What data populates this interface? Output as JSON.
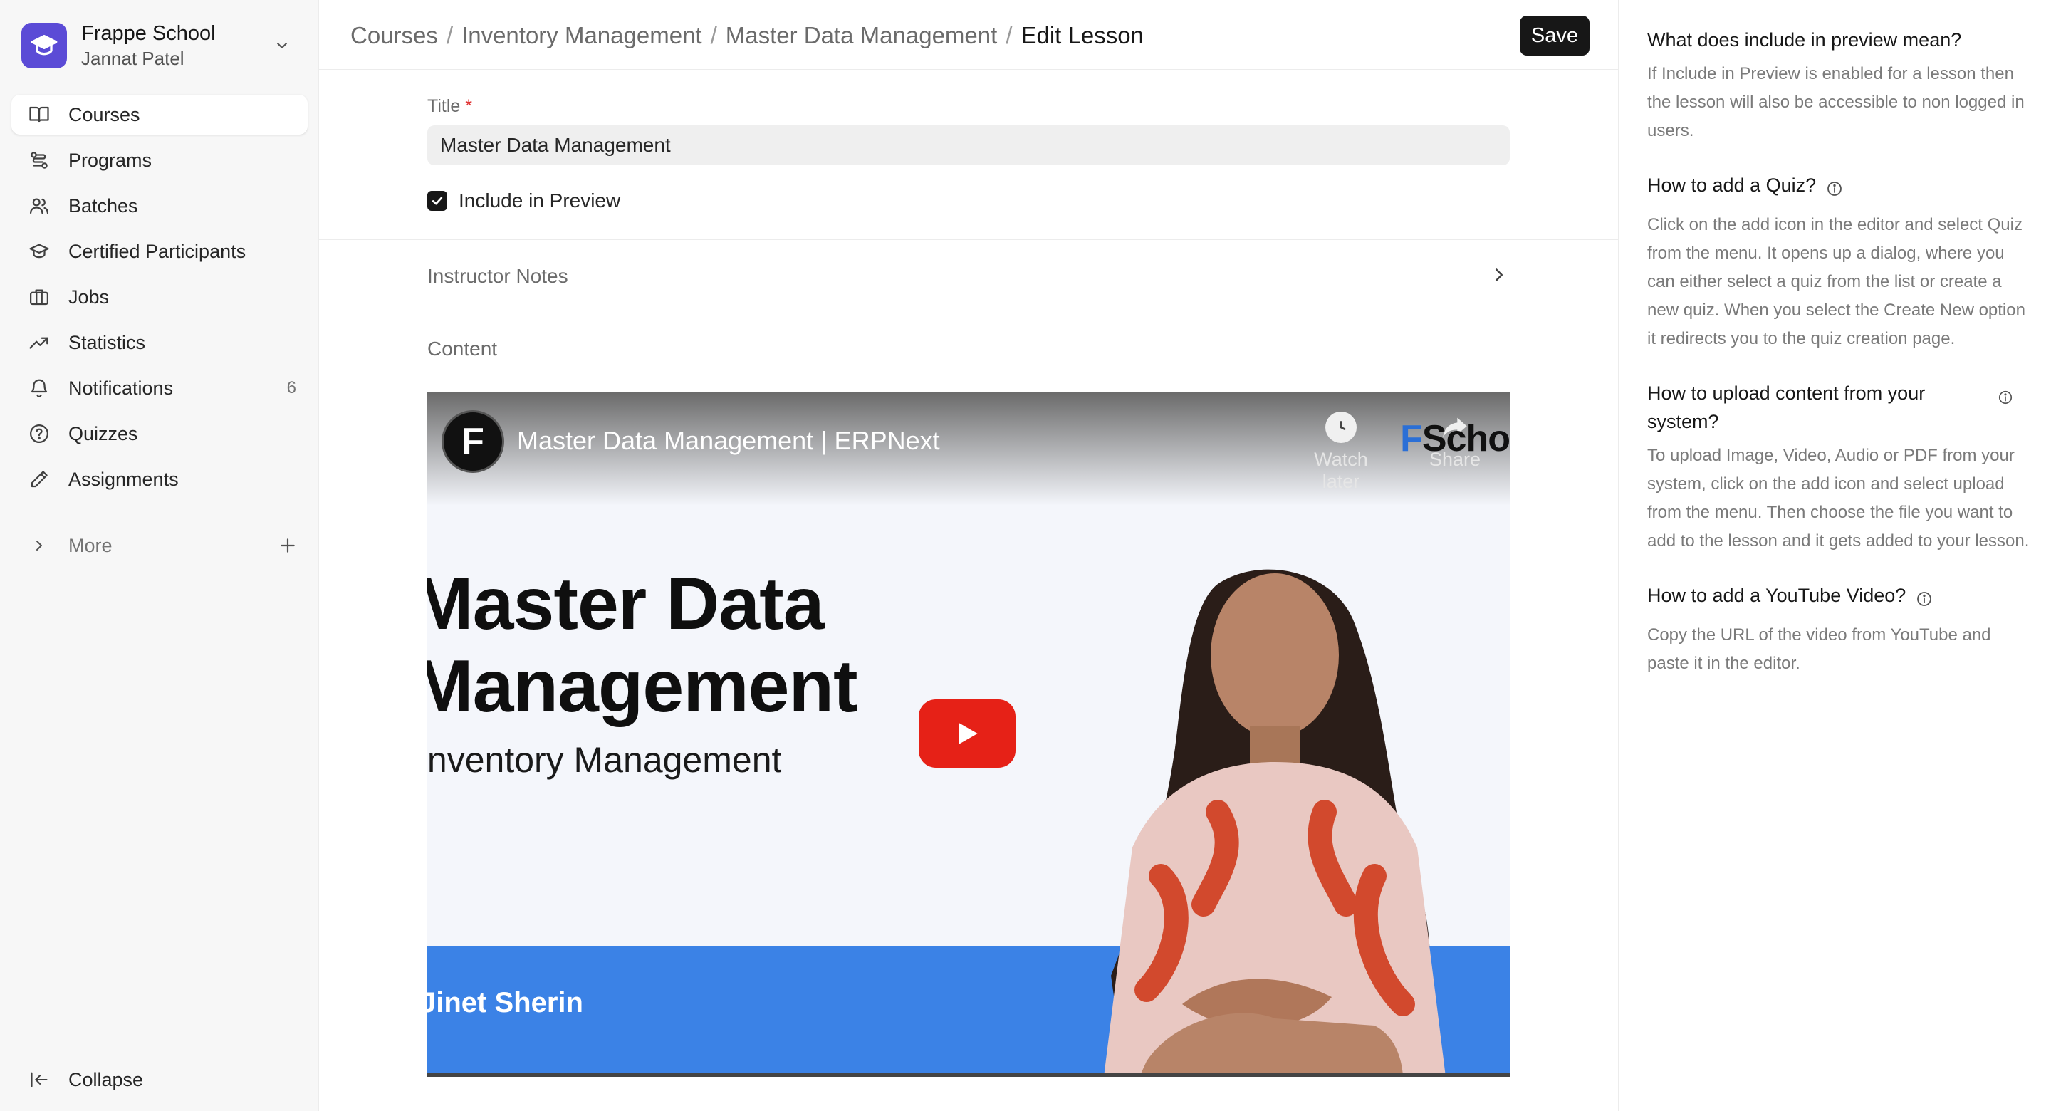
{
  "sidebar": {
    "brand_name": "Frappe School",
    "user_name": "Jannat Patel",
    "items": [
      {
        "label": "Courses",
        "icon": "book-icon",
        "active": true
      },
      {
        "label": "Programs",
        "icon": "route-icon"
      },
      {
        "label": "Batches",
        "icon": "users-icon"
      },
      {
        "label": "Certified Participants",
        "icon": "graduation-cap-icon"
      },
      {
        "label": "Jobs",
        "icon": "briefcase-icon"
      },
      {
        "label": "Statistics",
        "icon": "trending-up-icon"
      },
      {
        "label": "Notifications",
        "icon": "bell-icon",
        "count": "6"
      },
      {
        "label": "Quizzes",
        "icon": "help-circle-icon"
      },
      {
        "label": "Assignments",
        "icon": "pencil-icon"
      }
    ],
    "more_label": "More",
    "collapse_label": "Collapse"
  },
  "header": {
    "breadcrumb": [
      "Courses",
      "Inventory Management",
      "Master Data Management"
    ],
    "current": "Edit Lesson",
    "save_label": "Save"
  },
  "form": {
    "title_label": "Title",
    "required_mark": "*",
    "title_value": "Master Data Management",
    "include_preview_label": "Include in Preview",
    "include_preview_checked": true,
    "instructor_notes_label": "Instructor Notes",
    "content_label": "Content"
  },
  "video": {
    "channel_initial": "F",
    "title": "Master Data Management | ERPNext",
    "watch_later_label": "Watch later",
    "share_label": "Share",
    "brand_f": "F",
    "brand_rest": "Scho",
    "thumb_title_line1": "Master Data",
    "thumb_title_line2": "Management",
    "thumb_subtitle": "Inventory Management",
    "thumb_presenter": "Jinet Sherin",
    "colors": {
      "band": "#3b82e6",
      "play": "#e62117"
    }
  },
  "help": [
    {
      "q": "What does include in preview mean?",
      "info": false,
      "a": "If Include in Preview is enabled for a lesson then the lesson will also be accessible to non logged in users."
    },
    {
      "q": "How to add a Quiz?",
      "info": true,
      "a": "Click on the add icon in the editor and select Quiz from the menu. It opens up a dialog, where you can either select a quiz from the list or create a new quiz. When you select the Create New option it redirects you to the quiz creation page."
    },
    {
      "q": "How to upload content from your system?",
      "info": true,
      "a": "To upload Image, Video, Audio or PDF from your system, click on the add icon and select upload from the menu. Then choose the file you want to add to the lesson and it gets added to your lesson."
    },
    {
      "q": "How to add a YouTube Video?",
      "info": true,
      "a": "Copy the URL of the video from YouTube and paste it in the editor."
    }
  ]
}
